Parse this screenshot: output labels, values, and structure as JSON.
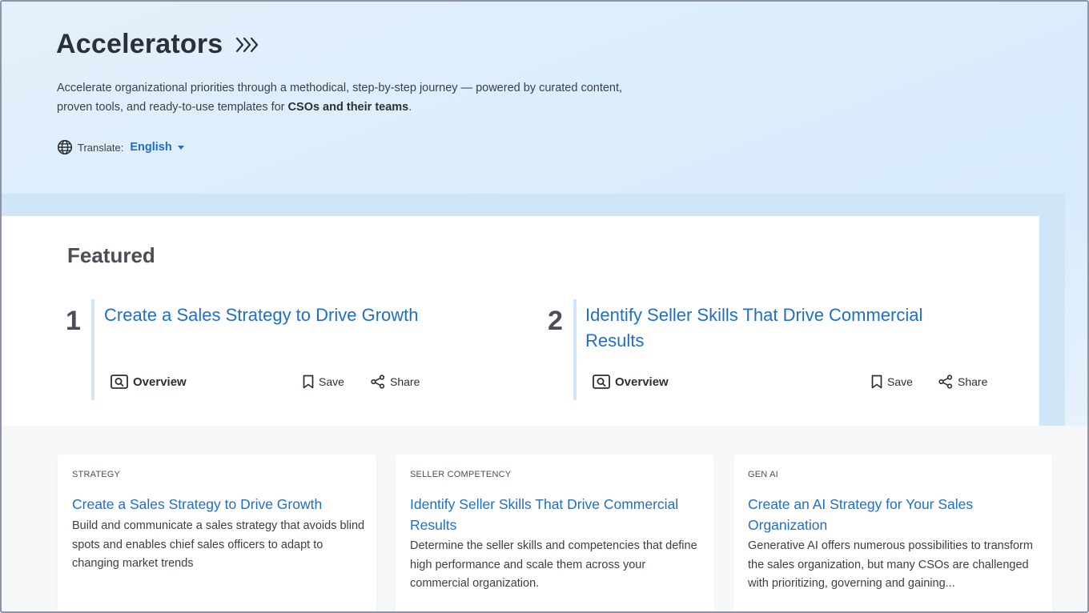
{
  "header": {
    "title": "Accelerators",
    "intro_prefix": "Accelerate organizational priorities through a methodical, step-by-step journey — powered by curated content, proven tools, and ready-to-use templates for ",
    "intro_bold": "CSOs and their teams",
    "intro_suffix": ".",
    "translate_label": "Translate:",
    "language": "English"
  },
  "featured": {
    "heading": "Featured",
    "items": [
      {
        "number": "1",
        "title": "Create a Sales Strategy to Drive Growth",
        "overview_label": "Overview",
        "save_label": "Save",
        "share_label": "Share"
      },
      {
        "number": "2",
        "title": "Identify Seller Skills That Drive Commercial Results",
        "overview_label": "Overview",
        "save_label": "Save",
        "share_label": "Share"
      }
    ]
  },
  "cards": [
    {
      "category": "STRATEGY",
      "title": "Create a Sales Strategy to Drive Growth",
      "description": "Build and communicate a sales strategy that avoids blind spots and enables chief sales officers to adapt to changing market trends"
    },
    {
      "category": "SELLER COMPETENCY",
      "title": "Identify Seller Skills That Drive Commercial Results",
      "description": "Determine the seller skills and competencies that define high performance and scale them across your commercial organization."
    },
    {
      "category": "GEN AI",
      "title": "Create an AI Strategy for Your Sales Organization",
      "description": "Generative AI offers numerous possibilities to transform the sales organization, but many CSOs are challenged with prioritizing, governing and gaining..."
    }
  ],
  "colors": {
    "accent": "#1f6fc5",
    "hero_bg": "#dcedfb",
    "stripe": "#cfe6f8",
    "text": "#2b2f36"
  }
}
